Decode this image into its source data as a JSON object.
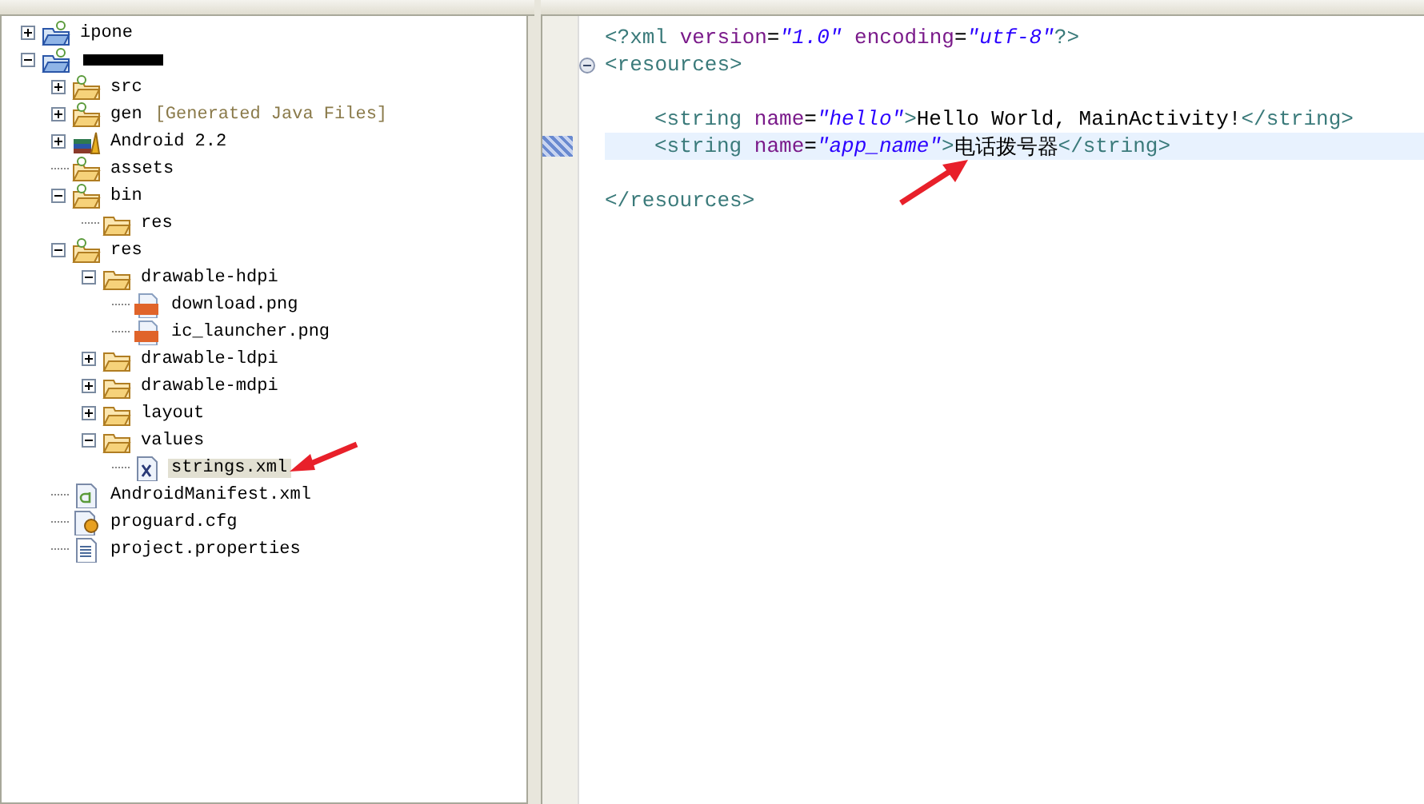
{
  "tree": [
    {
      "kind": "project",
      "label": "ipone",
      "expanded": false,
      "selected": false
    },
    {
      "kind": "project",
      "redacted": true,
      "expanded": true,
      "children": [
        {
          "kind": "src-folder",
          "label": "src",
          "expanded": false,
          "selected": false
        },
        {
          "kind": "src-folder",
          "label": "gen",
          "note": "[Generated Java Files]",
          "expanded": false,
          "selected": false
        },
        {
          "kind": "library",
          "label": "Android 2.2",
          "expanded": false,
          "selected": false
        },
        {
          "kind": "src-folder",
          "label": "assets",
          "selected": false
        },
        {
          "kind": "src-folder",
          "label": "bin",
          "expanded": true,
          "selected": false,
          "children": [
            {
              "kind": "folder",
              "label": "res",
              "selected": false
            }
          ]
        },
        {
          "kind": "src-folder",
          "label": "res",
          "expanded": true,
          "selected": false,
          "children": [
            {
              "kind": "folder",
              "label": "drawable-hdpi",
              "expanded": true,
              "selected": false,
              "children": [
                {
                  "kind": "png",
                  "label": "download.png",
                  "selected": false
                },
                {
                  "kind": "png",
                  "label": "ic_launcher.png",
                  "selected": false
                }
              ]
            },
            {
              "kind": "folder",
              "label": "drawable-ldpi",
              "expanded": false,
              "selected": false
            },
            {
              "kind": "folder",
              "label": "drawable-mdpi",
              "expanded": false,
              "selected": false
            },
            {
              "kind": "folder",
              "label": "layout",
              "expanded": false,
              "selected": false
            },
            {
              "kind": "folder",
              "label": "values",
              "expanded": true,
              "selected": false,
              "children": [
                {
                  "kind": "xml",
                  "label": "strings.xml",
                  "selected": true
                }
              ]
            }
          ]
        },
        {
          "kind": "manifest",
          "label": "AndroidManifest.xml",
          "selected": false
        },
        {
          "kind": "cfg",
          "label": "proguard.cfg",
          "selected": false
        },
        {
          "kind": "file",
          "label": "project.properties",
          "selected": false
        }
      ]
    }
  ],
  "editor": {
    "lines": [
      {
        "current": false,
        "indented": false,
        "tokens": [
          {
            "kind": "tag",
            "text": "<?xml "
          },
          {
            "kind": "attr",
            "text": "version"
          },
          {
            "kind": "punct",
            "text": "="
          },
          {
            "kind": "value",
            "text": "\"1.0\""
          },
          {
            "kind": "attr",
            "text": " encoding"
          },
          {
            "kind": "punct",
            "text": "="
          },
          {
            "kind": "value",
            "text": "\"utf-8\""
          },
          {
            "kind": "tag",
            "text": "?>"
          }
        ]
      },
      {
        "current": false,
        "indented": false,
        "blank_before": false,
        "foldable": true,
        "tokens": [
          {
            "kind": "tag",
            "text": "<resources>"
          }
        ]
      },
      {
        "current": false,
        "indented": true,
        "blank_before": true,
        "tokens": [
          {
            "kind": "tag",
            "text": "<string "
          },
          {
            "kind": "attr",
            "text": "name"
          },
          {
            "kind": "punct",
            "text": "="
          },
          {
            "kind": "value",
            "text": "\"hello\""
          },
          {
            "kind": "tag",
            "text": ">"
          },
          {
            "kind": "text",
            "text": "Hello World, MainActivity!"
          },
          {
            "kind": "tag",
            "text": "</string>"
          }
        ]
      },
      {
        "current": true,
        "indented": true,
        "blank_before": false,
        "tokens": [
          {
            "kind": "tag",
            "text": "<string "
          },
          {
            "kind": "attr",
            "text": "name"
          },
          {
            "kind": "punct",
            "text": "="
          },
          {
            "kind": "value",
            "text": "\"app_name\""
          },
          {
            "kind": "tag",
            "text": ">"
          },
          {
            "kind": "text",
            "text": "电话拨号器"
          },
          {
            "kind": "tag",
            "text": "</string>"
          }
        ]
      },
      {
        "current": false,
        "indented": false,
        "blank_before": true,
        "tokens": [
          {
            "kind": "tag",
            "text": "</resources>"
          }
        ]
      }
    ]
  }
}
